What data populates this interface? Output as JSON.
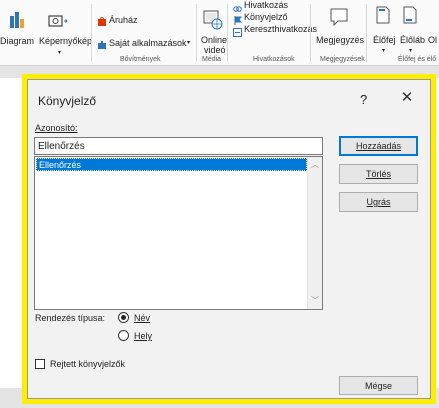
{
  "ribbon": {
    "diagram": "Diagram",
    "screenshot": "Képernyőkép",
    "store": "Áruház",
    "my_addins": "Saját alkalmazások",
    "addins_group": "Bővítmények",
    "online_video_1": "Online",
    "online_video_2": "videó",
    "media_group": "Média",
    "link": "Hivatkozás",
    "bookmark": "Könyvjelző",
    "cross_reference": "Kereszthivatkozás",
    "links_group": "Hivatkozások",
    "comment": "Megjegyzés",
    "comments_group": "Megjegyzések",
    "header": "Élőfej",
    "footer": "Élőláb",
    "page_number_partial": "Ol",
    "header_footer_group": "Élőfej és élő"
  },
  "dialog": {
    "title": "Könyvjelző",
    "help": "?",
    "close": "✕",
    "name_label": "Azonosító:",
    "name_value": "Ellenőrzés",
    "list_items": [
      "Ellenőrzés"
    ],
    "add_button": "Hozzáadás",
    "delete_button": "Törlés",
    "goto_button": "Ugrás",
    "sort_label": "Rendezés típusa:",
    "sort_name": "Név",
    "sort_location": "Hely",
    "sort_selected": "Név",
    "hidden_label": "Rejtett könyvjelzők",
    "hidden_checked": false,
    "cancel_button": "Mégse"
  },
  "colors": {
    "highlight_frame": "#ffee00",
    "selection": "#0078d7"
  }
}
